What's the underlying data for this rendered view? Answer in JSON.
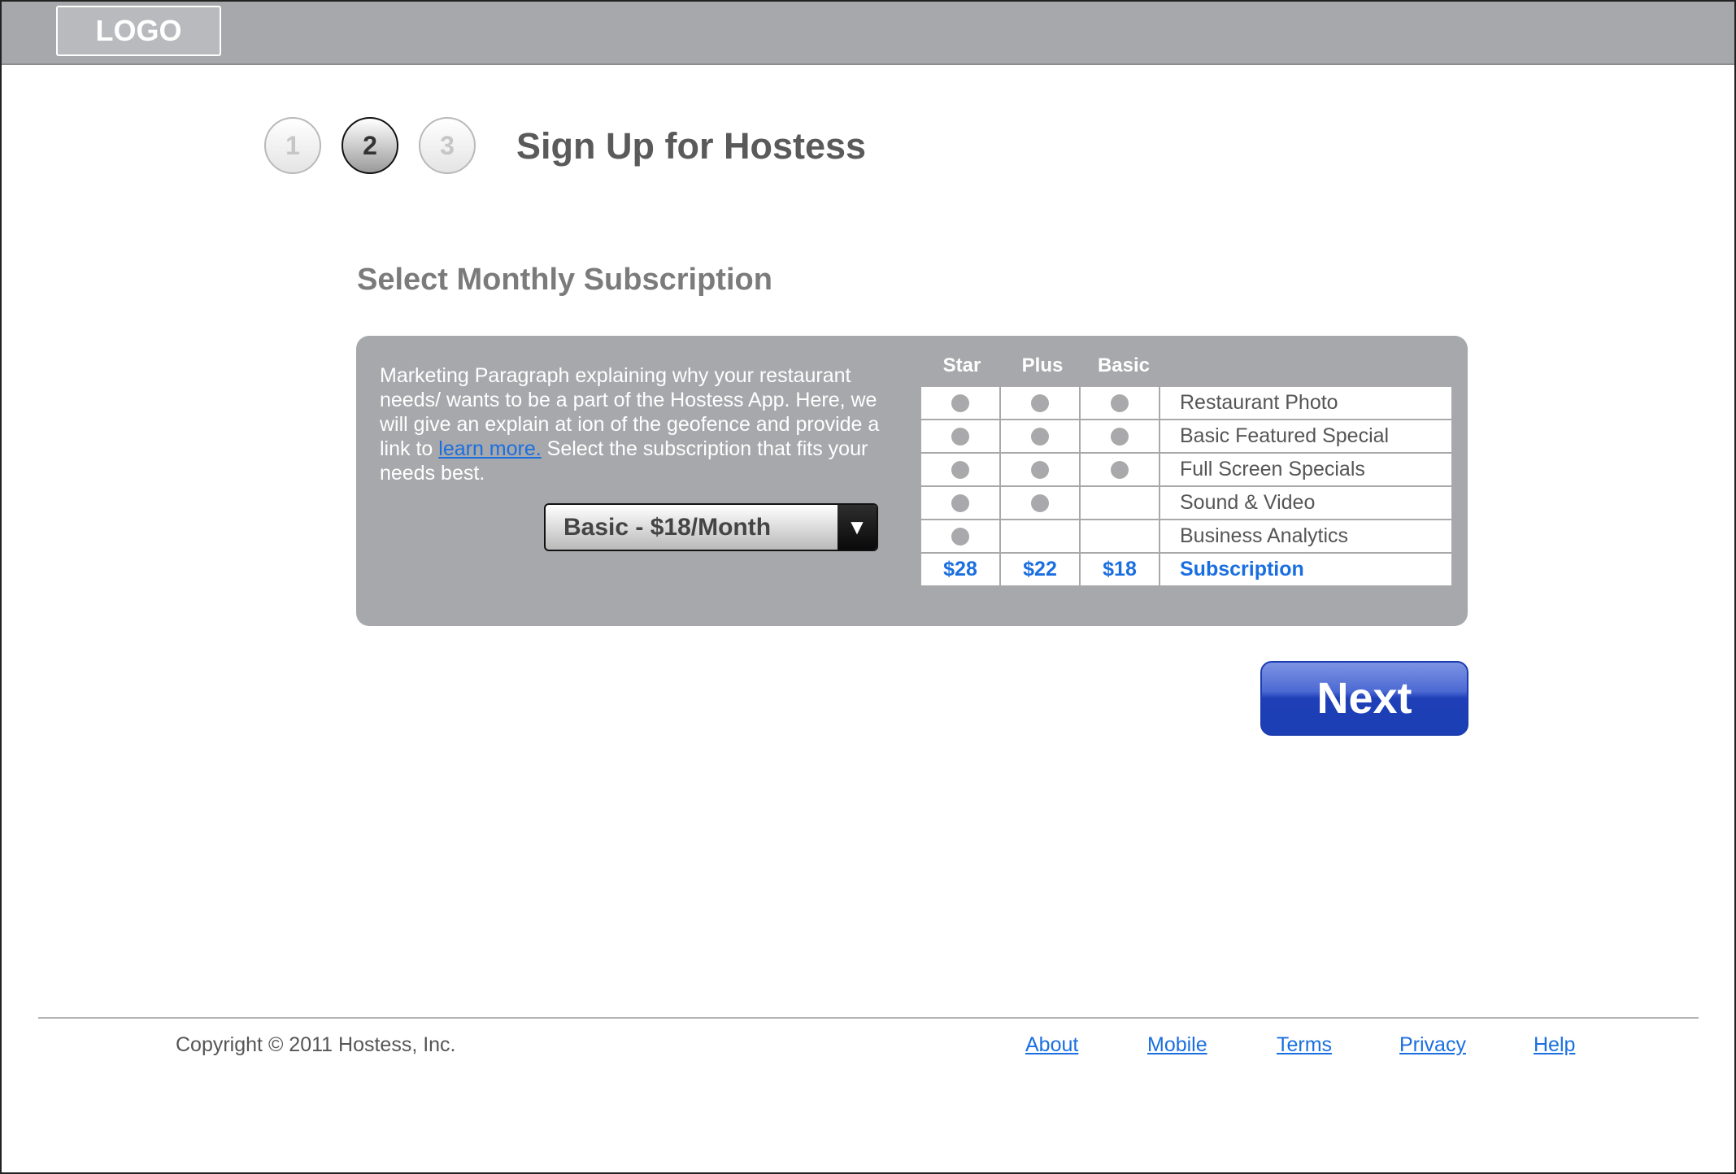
{
  "header": {
    "logo": "LOGO"
  },
  "steps": {
    "step1": "1",
    "step2": "2",
    "step3": "3",
    "active": "2"
  },
  "page_title": "Sign Up for Hostess",
  "section_title": "Select Monthly Subscription",
  "marketing": {
    "text_before": "Marketing Paragraph explaining why your restaurant needs/ wants to be a part of the Hostess App. Here, we will give an explain at ion of the geofence and provide a link to ",
    "link": "learn more.",
    "text_after": " Select the subscription that fits your needs best."
  },
  "subscription_select": {
    "value": "Basic - $18/Month",
    "arrow": "▼"
  },
  "plans": {
    "headers": [
      "Star",
      "Plus",
      "Basic"
    ],
    "features": [
      {
        "label": "Restaurant Photo",
        "star": true,
        "plus": true,
        "basic": true
      },
      {
        "label": "Basic Featured Special",
        "star": true,
        "plus": true,
        "basic": true
      },
      {
        "label": "Full Screen Specials",
        "star": true,
        "plus": true,
        "basic": true
      },
      {
        "label": "Sound & Video",
        "star": true,
        "plus": true,
        "basic": false
      },
      {
        "label": "Business Analytics",
        "star": true,
        "plus": false,
        "basic": false
      }
    ],
    "prices": [
      "$28",
      "$22",
      "$18"
    ],
    "price_label": "Subscription"
  },
  "next_button": "Next",
  "footer": {
    "copyright": "Copyright © 2011 Hostess, Inc.",
    "links": [
      "About",
      "Mobile",
      "Terms",
      "Privacy",
      "Help"
    ]
  },
  "colors": {
    "header_bg": "#a7a8ab",
    "panel_bg": "#a7a8ab",
    "link_blue": "#1a6fe0",
    "button_blue": "#1e3fb7"
  }
}
